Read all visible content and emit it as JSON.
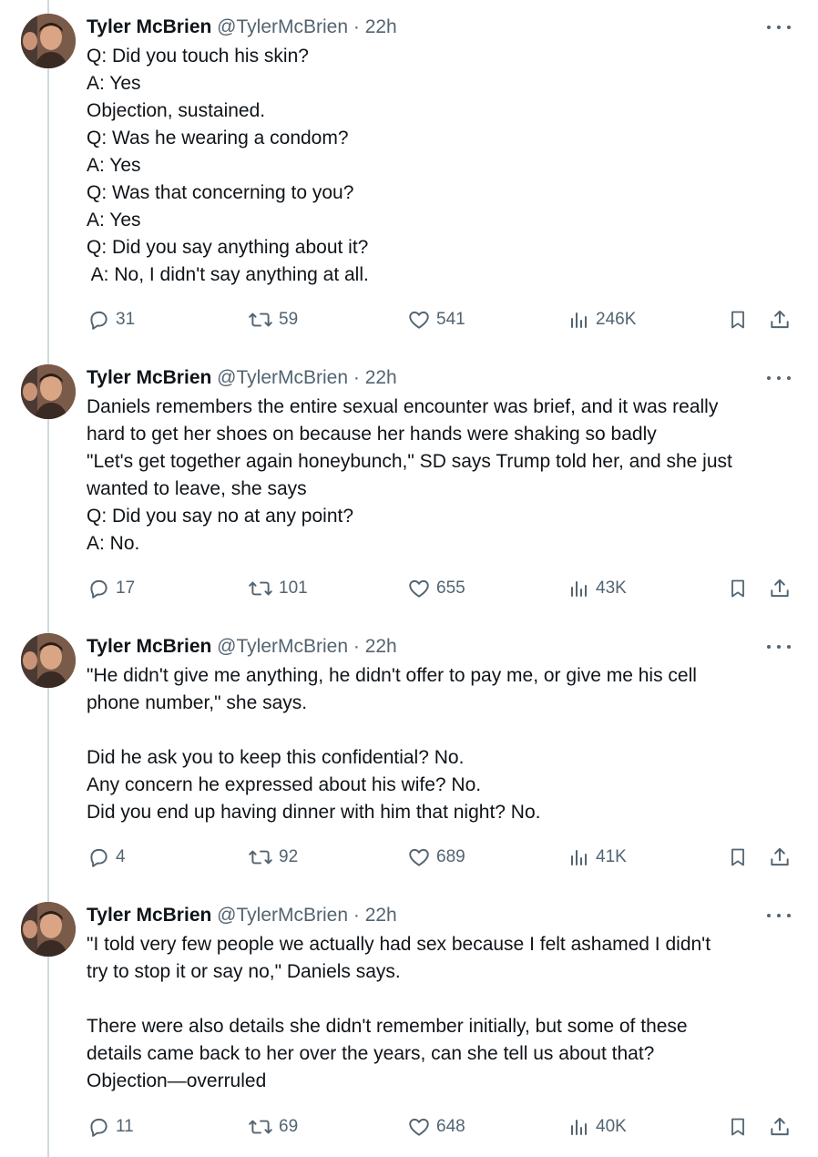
{
  "colors": {
    "text": "#0f1419",
    "secondary": "#536471",
    "thread_line": "#cfd9de"
  },
  "tweets": [
    {
      "author": "Tyler McBrien",
      "handle": "@TylerMcBrien",
      "separator": "·",
      "time": "22h",
      "lines": [
        "Q: Did you touch his skin?",
        "A: Yes",
        "Objection, sustained.",
        "Q: Was he wearing a condom?",
        "A: Yes",
        "Q: Was that concerning to you?",
        "A: Yes",
        "Q: Did you say anything about it?",
        " A: No, I didn't say anything at all."
      ],
      "replies": "31",
      "reposts": "59",
      "likes": "541",
      "views": "246K"
    },
    {
      "author": "Tyler McBrien",
      "handle": "@TylerMcBrien",
      "separator": "·",
      "time": "22h",
      "lines": [
        "Daniels remembers the entire sexual encounter was brief, and it was really",
        "hard to get her shoes on because her hands were shaking so badly",
        "\"Let's get together again honeybunch,\" SD says Trump told her, and she just",
        "wanted to leave, she says",
        "Q: Did you say no at any point?",
        "A: No."
      ],
      "replies": "17",
      "reposts": "101",
      "likes": "655",
      "views": "43K"
    },
    {
      "author": "Tyler McBrien",
      "handle": "@TylerMcBrien",
      "separator": "·",
      "time": "22h",
      "lines": [
        "\"He didn't give me anything, he didn't offer to pay me, or give me his cell",
        "phone number,\" she says.",
        "",
        "Did he ask you to keep this confidential? No.",
        "Any concern he expressed about his wife? No.",
        "Did you end up having dinner with him that night? No."
      ],
      "replies": "4",
      "reposts": "92",
      "likes": "689",
      "views": "41K"
    },
    {
      "author": "Tyler McBrien",
      "handle": "@TylerMcBrien",
      "separator": "·",
      "time": "22h",
      "lines": [
        "\"I told very few people we actually had sex because I felt ashamed I didn't",
        "try to stop it or say no,\" Daniels says.",
        "",
        "There were also details she didn't remember initially, but some of these",
        "details came back to her over the years, can she tell us about that?",
        "Objection—overruled"
      ],
      "replies": "11",
      "reposts": "69",
      "likes": "648",
      "views": "40K"
    }
  ]
}
